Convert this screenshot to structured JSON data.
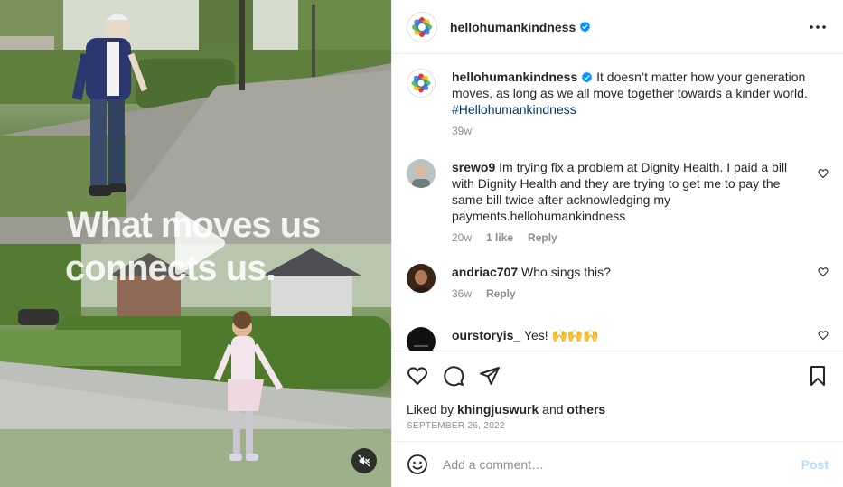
{
  "media": {
    "overlay_line1": "What moves us",
    "overlay_line2": "connects us.",
    "play_icon": "play-icon",
    "mute_icon": "speaker-muted-icon"
  },
  "header": {
    "username": "hellohumankindness",
    "verified_icon": "verified-badge-icon",
    "more_icon": "more-horizontal-icon"
  },
  "caption": {
    "username": "hellohumankindness",
    "text": " It doesn’t matter how your generation moves, as long as we all move together towards a kinder world. ",
    "hashtag": "#Hellohumankindness",
    "time": "39w"
  },
  "comments": [
    {
      "username": "srewo9",
      "text": " Im trying fix a problem at Dignity Health. I paid a bill with Dignity Health and they are trying to get me to pay the same bill twice after acknowledging my payments.hellohumankindness",
      "time": "20w",
      "likes": "1 like",
      "reply": "Reply"
    },
    {
      "username": "andriac707",
      "text": " Who sings this?",
      "time": "36w",
      "reply": "Reply"
    },
    {
      "username": "ourstoryis_",
      "text": " Yes! 🙌🙌🙌"
    }
  ],
  "actions": {
    "like_icon": "heart-icon",
    "comment_icon": "comment-icon",
    "share_icon": "share-icon",
    "save_icon": "bookmark-icon",
    "liked_by_prefix": "Liked by ",
    "liked_by_user": "khingjuswurk",
    "liked_by_and": " and ",
    "liked_by_others": "others",
    "date": "SEPTEMBER 26, 2022"
  },
  "add_comment": {
    "emoji_icon": "emoji-icon",
    "placeholder": "Add a comment…",
    "post_label": "Post"
  },
  "colors": {
    "link": "#00376b",
    "muted": "#8e8e8e",
    "verified": "#0095f6",
    "post_disabled": "#b2dffc"
  }
}
